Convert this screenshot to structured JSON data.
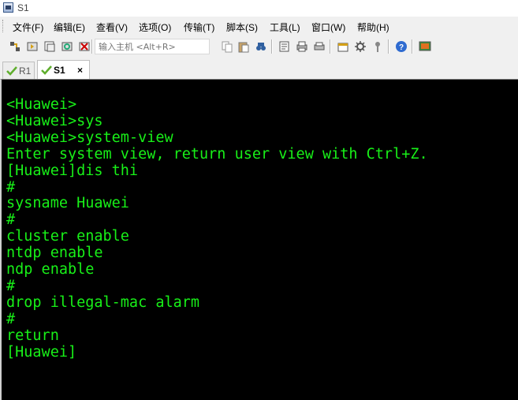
{
  "window": {
    "title": "S1",
    "icon": "app-window-icon"
  },
  "menu": {
    "items": [
      {
        "label": "文件(F)"
      },
      {
        "label": "编辑(E)"
      },
      {
        "label": "查看(V)"
      },
      {
        "label": "选项(O)"
      },
      {
        "label": "传输(T)"
      },
      {
        "label": "脚本(S)"
      },
      {
        "label": "工具(L)"
      },
      {
        "label": "窗口(W)"
      },
      {
        "label": "帮助(H)"
      }
    ]
  },
  "toolbar": {
    "host_input": {
      "value": "",
      "placeholder": "输入主机 <Alt+R>"
    },
    "icons": [
      "connect-icon",
      "quick-connect-icon",
      "connect-tab-icon",
      "reconnect-icon",
      "disconnect-icon",
      "copy-icon",
      "paste-icon",
      "find-icon",
      "print-setup-icon",
      "print-icon",
      "print-screen-icon",
      "session-options-icon",
      "global-options-icon",
      "keymap-icon",
      "help-icon",
      "monitor-icon"
    ]
  },
  "tabs": [
    {
      "label": "R1",
      "status": "connected",
      "active": false
    },
    {
      "label": "S1",
      "status": "connected",
      "active": true,
      "close": "×"
    }
  ],
  "colors": {
    "terminal_bg": "#000000",
    "terminal_fg": "#18f018",
    "check": "#5fae2d"
  },
  "terminal": {
    "lines": [
      "",
      "<Huawei>",
      "<Huawei>sys",
      "<Huawei>system-view",
      "Enter system view, return user view with Ctrl+Z.",
      "[Huawei]dis thi",
      "#",
      "sysname Huawei",
      "#",
      "cluster enable",
      "ntdp enable",
      "ndp enable",
      "#",
      "drop illegal-mac alarm",
      "#",
      "return",
      "[Huawei]"
    ]
  }
}
